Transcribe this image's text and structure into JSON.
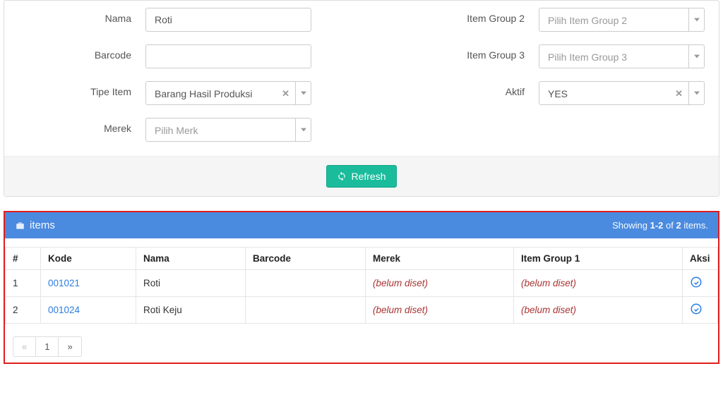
{
  "form": {
    "nama": {
      "label": "Nama",
      "value": "Roti"
    },
    "barcode": {
      "label": "Barcode",
      "value": ""
    },
    "tipe_item": {
      "label": "Tipe Item",
      "value": "Barang Hasil Produksi",
      "clearable": true
    },
    "merek": {
      "label": "Merek",
      "placeholder": "Pilih Merk",
      "value": ""
    },
    "item_group_2": {
      "label": "Item Group 2",
      "placeholder": "Pilih Item Group 2",
      "value": ""
    },
    "item_group_3": {
      "label": "Item Group 3",
      "placeholder": "Pilih Item Group 3",
      "value": ""
    },
    "aktif": {
      "label": "Aktif",
      "value": "YES",
      "clearable": true
    },
    "refresh_label": "Refresh"
  },
  "items_panel": {
    "title": "items",
    "summary_prefix": "Showing ",
    "summary_range": "1-2",
    "summary_mid": " of ",
    "summary_total": "2",
    "summary_suffix": " items.",
    "columns": {
      "num": "#",
      "kode": "Kode",
      "nama": "Nama",
      "barcode": "Barcode",
      "merek": "Merek",
      "group1": "Item Group 1",
      "aksi": "Aksi"
    },
    "rows": [
      {
        "num": "1",
        "kode": "001021",
        "nama": "Roti",
        "barcode": "",
        "merek": "(belum diset)",
        "group1": "(belum diset)"
      },
      {
        "num": "2",
        "kode": "001024",
        "nama": "Roti Keju",
        "barcode": "",
        "merek": "(belum diset)",
        "group1": "(belum diset)"
      }
    ],
    "pagination": {
      "prev": "«",
      "current": "1",
      "next": "»"
    }
  }
}
